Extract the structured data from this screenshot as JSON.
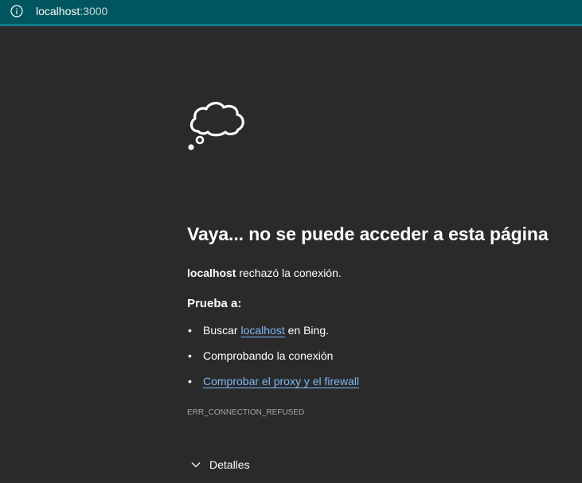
{
  "address_bar": {
    "host": "localhost",
    "port": ":3000"
  },
  "error_page": {
    "icon": "thought-cloud-icon",
    "headline": "Vaya... no se puede acceder a esta página",
    "refused_host": "localhost",
    "refused_text": " rechazó la conexión.",
    "try_label": "Prueba a:",
    "suggestions": {
      "search_prefix": "Buscar ",
      "search_link": "localhost",
      "search_suffix": " en Bing.",
      "check_connection": "Comprobando la conexión",
      "check_proxy_link": "Comprobar el proxy y el firewall"
    },
    "error_code": "ERR_CONNECTION_REFUSED",
    "details_label": "Detalles"
  },
  "colors": {
    "background": "#2b2a2a",
    "address_bar": "#00565f",
    "link": "#7ab8f5"
  }
}
